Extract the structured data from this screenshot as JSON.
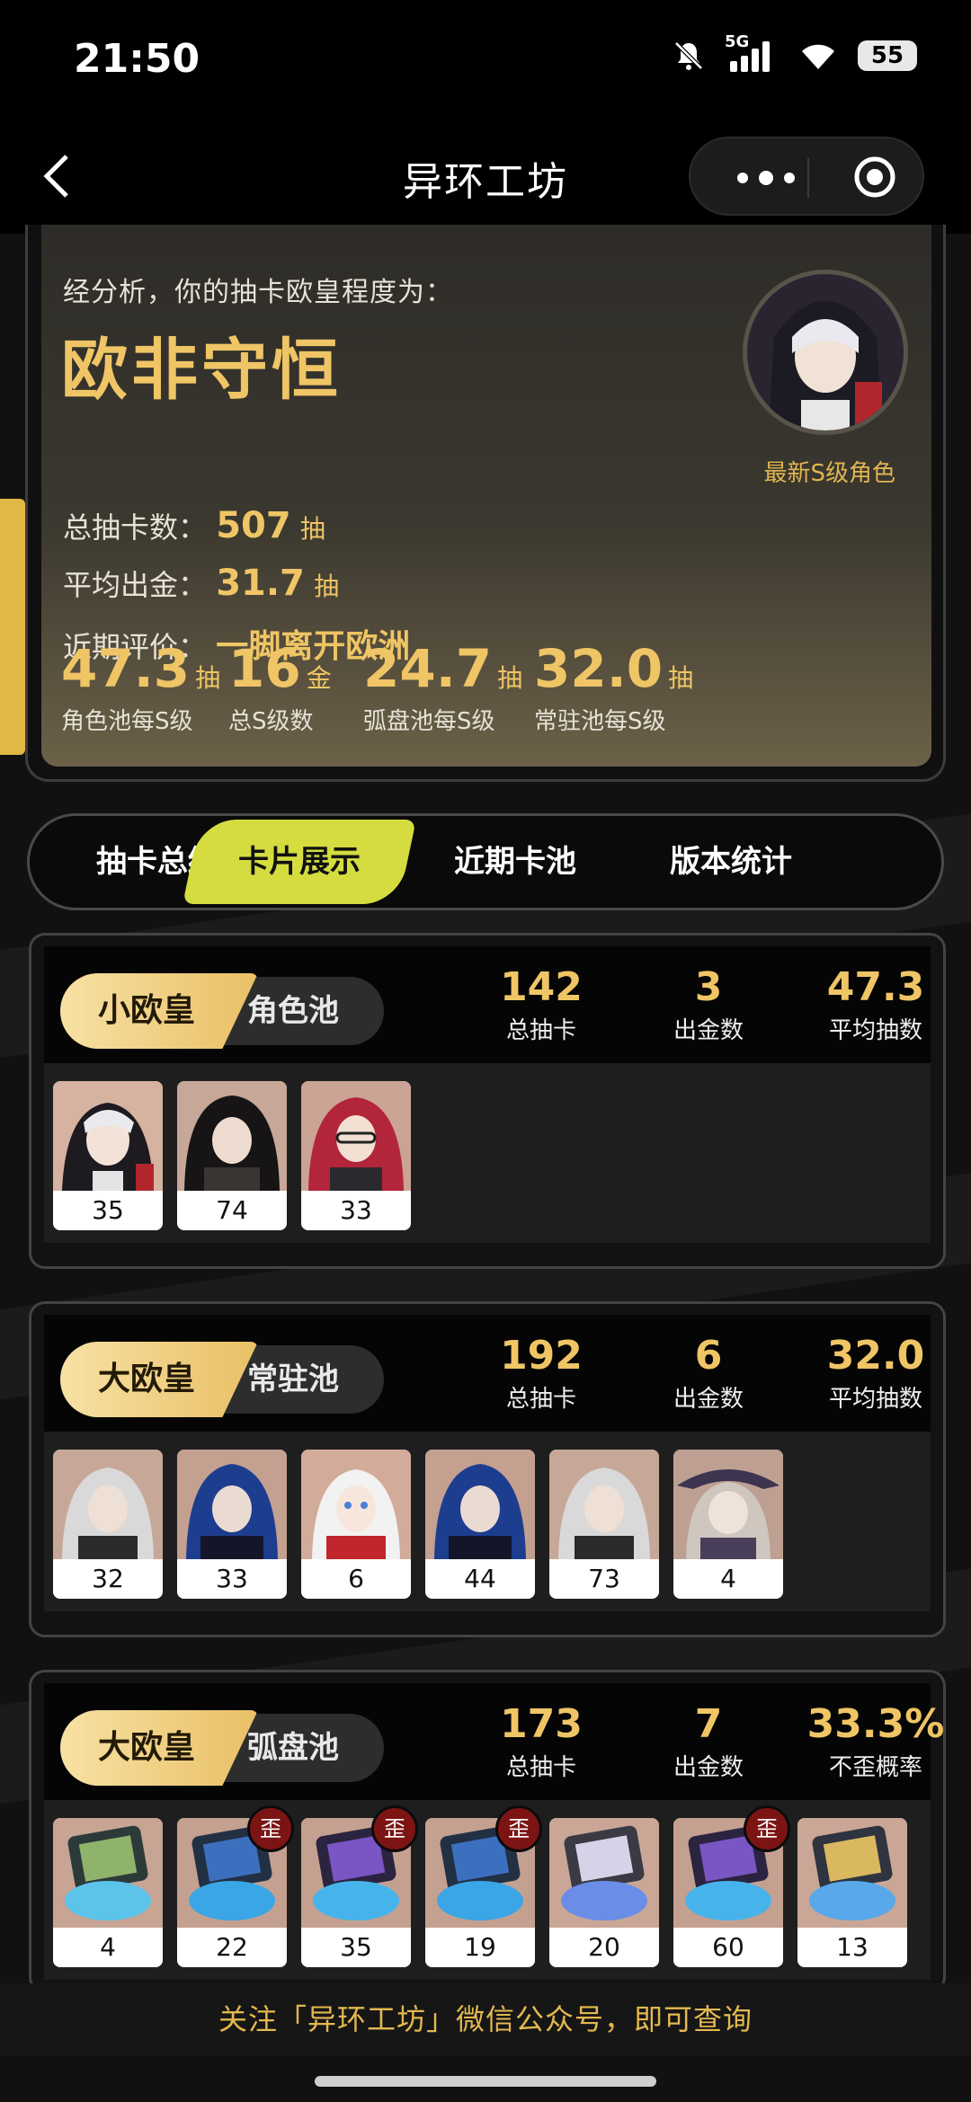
{
  "status_bar": {
    "time": "21:50",
    "network": "5G",
    "battery": "55"
  },
  "nav": {
    "title": "异环工坊"
  },
  "summary": {
    "intro": "经分析，你的抽卡欧皇程度为：",
    "grade": "欧非守恒",
    "total_pulls_label": "总抽卡数：",
    "total_pulls_value": "507",
    "avg_gold_label": "平均出金：",
    "avg_gold_value": "31.7",
    "recent_label": "近期评价：",
    "recent_value": "一脚离开欧洲",
    "unit_pull": "抽",
    "unit_gold": "金",
    "avatar_caption": "最新S级角色",
    "stats": [
      {
        "value": "47.3",
        "unit": "抽",
        "caption": "角色池每S级"
      },
      {
        "value": "16",
        "unit": "金",
        "caption": "总S级数"
      },
      {
        "value": "24.7",
        "unit": "抽",
        "caption": "弧盘池每S级"
      },
      {
        "value": "32.0",
        "unit": "抽",
        "caption": "常驻池每S级"
      }
    ]
  },
  "tabs": [
    "抽卡总结",
    "卡片展示",
    "近期卡池",
    "版本统计"
  ],
  "active_tab": "卡片展示",
  "pools": [
    {
      "rank": "小欧皇",
      "pool_name": "角色池",
      "stats": [
        {
          "value": "142",
          "label": "总抽卡"
        },
        {
          "value": "3",
          "label": "出金数"
        },
        {
          "value": "47.3",
          "label": "平均抽数"
        }
      ],
      "cards": [
        "35",
        "74",
        "33"
      ]
    },
    {
      "rank": "大欧皇",
      "pool_name": "常驻池",
      "stats": [
        {
          "value": "192",
          "label": "总抽卡"
        },
        {
          "value": "6",
          "label": "出金数"
        },
        {
          "value": "32.0",
          "label": "平均抽数"
        }
      ],
      "cards": [
        "32",
        "33",
        "6",
        "44",
        "73",
        "4"
      ]
    },
    {
      "rank": "大欧皇",
      "pool_name": "弧盘池",
      "stats": [
        {
          "value": "173",
          "label": "总抽卡"
        },
        {
          "value": "7",
          "label": "出金数"
        },
        {
          "value": "33.3%",
          "label": "不歪概率"
        }
      ],
      "cards": [
        "4",
        "22",
        "35",
        "19",
        "20",
        "60",
        "13"
      ],
      "off_banner_mark": "歪"
    }
  ],
  "footer": "关注「异环工坊」微信公众号，即可查询",
  "colors": {
    "accent_gold": "#efc565",
    "tab_active": "#d4dc3f"
  }
}
